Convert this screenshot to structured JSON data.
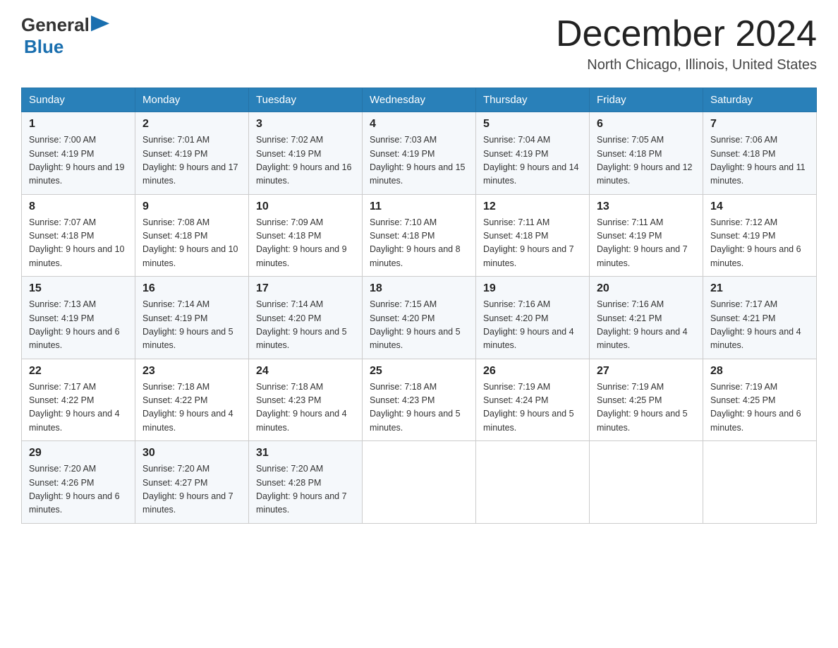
{
  "header": {
    "logo_general": "General",
    "logo_blue": "Blue",
    "month_title": "December 2024",
    "location": "North Chicago, Illinois, United States"
  },
  "days_of_week": [
    "Sunday",
    "Monday",
    "Tuesday",
    "Wednesday",
    "Thursday",
    "Friday",
    "Saturday"
  ],
  "weeks": [
    [
      {
        "day": "1",
        "sunrise": "7:00 AM",
        "sunset": "4:19 PM",
        "daylight": "9 hours and 19 minutes."
      },
      {
        "day": "2",
        "sunrise": "7:01 AM",
        "sunset": "4:19 PM",
        "daylight": "9 hours and 17 minutes."
      },
      {
        "day": "3",
        "sunrise": "7:02 AM",
        "sunset": "4:19 PM",
        "daylight": "9 hours and 16 minutes."
      },
      {
        "day": "4",
        "sunrise": "7:03 AM",
        "sunset": "4:19 PM",
        "daylight": "9 hours and 15 minutes."
      },
      {
        "day": "5",
        "sunrise": "7:04 AM",
        "sunset": "4:19 PM",
        "daylight": "9 hours and 14 minutes."
      },
      {
        "day": "6",
        "sunrise": "7:05 AM",
        "sunset": "4:18 PM",
        "daylight": "9 hours and 12 minutes."
      },
      {
        "day": "7",
        "sunrise": "7:06 AM",
        "sunset": "4:18 PM",
        "daylight": "9 hours and 11 minutes."
      }
    ],
    [
      {
        "day": "8",
        "sunrise": "7:07 AM",
        "sunset": "4:18 PM",
        "daylight": "9 hours and 10 minutes."
      },
      {
        "day": "9",
        "sunrise": "7:08 AM",
        "sunset": "4:18 PM",
        "daylight": "9 hours and 10 minutes."
      },
      {
        "day": "10",
        "sunrise": "7:09 AM",
        "sunset": "4:18 PM",
        "daylight": "9 hours and 9 minutes."
      },
      {
        "day": "11",
        "sunrise": "7:10 AM",
        "sunset": "4:18 PM",
        "daylight": "9 hours and 8 minutes."
      },
      {
        "day": "12",
        "sunrise": "7:11 AM",
        "sunset": "4:18 PM",
        "daylight": "9 hours and 7 minutes."
      },
      {
        "day": "13",
        "sunrise": "7:11 AM",
        "sunset": "4:19 PM",
        "daylight": "9 hours and 7 minutes."
      },
      {
        "day": "14",
        "sunrise": "7:12 AM",
        "sunset": "4:19 PM",
        "daylight": "9 hours and 6 minutes."
      }
    ],
    [
      {
        "day": "15",
        "sunrise": "7:13 AM",
        "sunset": "4:19 PM",
        "daylight": "9 hours and 6 minutes."
      },
      {
        "day": "16",
        "sunrise": "7:14 AM",
        "sunset": "4:19 PM",
        "daylight": "9 hours and 5 minutes."
      },
      {
        "day": "17",
        "sunrise": "7:14 AM",
        "sunset": "4:20 PM",
        "daylight": "9 hours and 5 minutes."
      },
      {
        "day": "18",
        "sunrise": "7:15 AM",
        "sunset": "4:20 PM",
        "daylight": "9 hours and 5 minutes."
      },
      {
        "day": "19",
        "sunrise": "7:16 AM",
        "sunset": "4:20 PM",
        "daylight": "9 hours and 4 minutes."
      },
      {
        "day": "20",
        "sunrise": "7:16 AM",
        "sunset": "4:21 PM",
        "daylight": "9 hours and 4 minutes."
      },
      {
        "day": "21",
        "sunrise": "7:17 AM",
        "sunset": "4:21 PM",
        "daylight": "9 hours and 4 minutes."
      }
    ],
    [
      {
        "day": "22",
        "sunrise": "7:17 AM",
        "sunset": "4:22 PM",
        "daylight": "9 hours and 4 minutes."
      },
      {
        "day": "23",
        "sunrise": "7:18 AM",
        "sunset": "4:22 PM",
        "daylight": "9 hours and 4 minutes."
      },
      {
        "day": "24",
        "sunrise": "7:18 AM",
        "sunset": "4:23 PM",
        "daylight": "9 hours and 4 minutes."
      },
      {
        "day": "25",
        "sunrise": "7:18 AM",
        "sunset": "4:23 PM",
        "daylight": "9 hours and 5 minutes."
      },
      {
        "day": "26",
        "sunrise": "7:19 AM",
        "sunset": "4:24 PM",
        "daylight": "9 hours and 5 minutes."
      },
      {
        "day": "27",
        "sunrise": "7:19 AM",
        "sunset": "4:25 PM",
        "daylight": "9 hours and 5 minutes."
      },
      {
        "day": "28",
        "sunrise": "7:19 AM",
        "sunset": "4:25 PM",
        "daylight": "9 hours and 6 minutes."
      }
    ],
    [
      {
        "day": "29",
        "sunrise": "7:20 AM",
        "sunset": "4:26 PM",
        "daylight": "9 hours and 6 minutes."
      },
      {
        "day": "30",
        "sunrise": "7:20 AM",
        "sunset": "4:27 PM",
        "daylight": "9 hours and 7 minutes."
      },
      {
        "day": "31",
        "sunrise": "7:20 AM",
        "sunset": "4:28 PM",
        "daylight": "9 hours and 7 minutes."
      },
      null,
      null,
      null,
      null
    ]
  ]
}
